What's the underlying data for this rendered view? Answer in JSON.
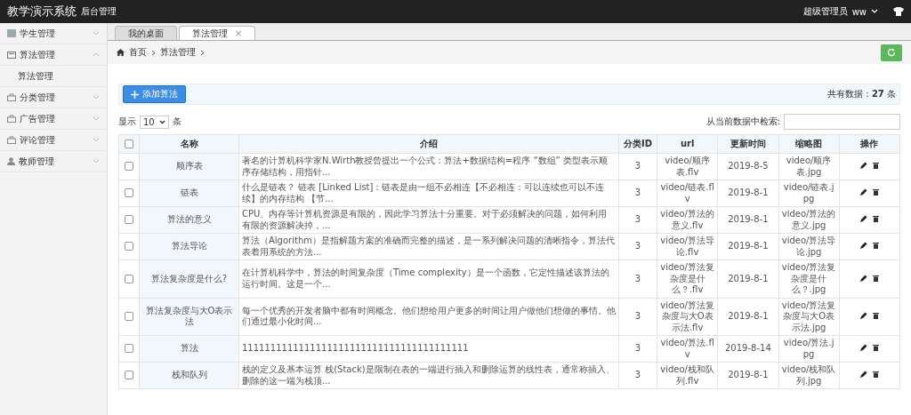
{
  "header": {
    "title": "教学演示系统",
    "subtitle": "后台管理",
    "user_role": "超级管理员",
    "user_name": "ww"
  },
  "sidebar": {
    "items": [
      {
        "label": "学生管理",
        "expanded": false
      },
      {
        "label": "算法管理",
        "expanded": true,
        "children": [
          {
            "label": "算法管理"
          }
        ]
      },
      {
        "label": "分类管理",
        "expanded": false
      },
      {
        "label": "广告管理",
        "expanded": false
      },
      {
        "label": "评论管理",
        "expanded": false
      },
      {
        "label": "教师管理",
        "expanded": false
      }
    ]
  },
  "tabs": [
    {
      "label": "我的桌面",
      "selected": false
    },
    {
      "label": "算法管理",
      "selected": true,
      "close": "×"
    }
  ],
  "breadcrumb": [
    "首页",
    "算法管理"
  ],
  "toolbar": {
    "add_button": "添加算法",
    "total_label": "共有数据：",
    "total": "27",
    "total_unit": "条"
  },
  "length_menu": {
    "prefix": "显示",
    "value": "10",
    "suffix": "条"
  },
  "search": {
    "label": "从当前数据中检索:"
  },
  "table": {
    "select_all_checked": false,
    "columns": [
      "名称",
      "介绍",
      "分类ID",
      "url",
      "更新时间",
      "缩略图",
      "操作"
    ],
    "rows": [
      {
        "checked": false,
        "name": "顺序表",
        "intro": "著名的计算机科学家N.Wirth教授曾提出一个公式：算法+数据结构=程序 “数组” 类型表示顺序存储结构，用指针...",
        "category": "3",
        "url": "video/顺序表.flv",
        "updated": "2019-8-5",
        "thumb": "video/顺序表.jpg"
      },
      {
        "checked": false,
        "name": "链表",
        "intro": "什么是链表？ 链表 [Linked List]：链表是由一组不必相连【不必相连：可以连续也可以不连续】的内存结构 【节...",
        "category": "3",
        "url": "video/链表.flv",
        "updated": "2019-8-1",
        "thumb": "video/链表.jpg"
      },
      {
        "checked": false,
        "name": "算法的意义",
        "intro": "CPU、内存等计算机资源是有限的，因此学习算法十分重要。对于必须解决的问题，如何利用有限的资源解决掉，...",
        "category": "3",
        "url": "video/算法的意义.flv",
        "updated": "2019-8-1",
        "thumb": "video/算法的意义.jpg"
      },
      {
        "checked": false,
        "name": "算法导论",
        "intro": "算法（Algorithm）是指解题方案的准确而完整的描述，是一系列解决问题的清晰指令，算法代表着用系统的方法...",
        "category": "3",
        "url": "video/算法导论.flv",
        "updated": "2019-8-1",
        "thumb": "video/算法导论.jpg"
      },
      {
        "checked": false,
        "name": "算法复杂度是什么?",
        "intro": "在计算机科学中，算法的时间复杂度（Time complexity）是一个函数，它定性描述该算法的运行时间。这是一个...",
        "category": "3",
        "url": "video/算法复杂度是什么？.flv",
        "updated": "2019-8-1",
        "thumb": "video/算法复杂度是什么？.jpg"
      },
      {
        "checked": false,
        "name": "算法复杂度与大O表示法",
        "intro": "每一个优秀的开发者脑中都有时间概念。他们想给用户更多的时间让用户做他们想做的事情。他们通过最小化时间...",
        "category": "3",
        "url": "video/算法复杂度与大O表示法.flv",
        "updated": "2019-8-1",
        "thumb": "video/算法复杂度与大O表示法.jpg"
      },
      {
        "checked": false,
        "name": "算法",
        "intro": "1111111111111111111111111111111111111111",
        "category": "3",
        "url": "video/算法.flv",
        "updated": "2019-8-14",
        "thumb": "video/算法.jpg"
      },
      {
        "checked": false,
        "name": "栈和队列",
        "intro": "栈的定义及基本运算 栈(Stack)是限制在表的一端进行插入和删除运算的线性表，通常称插入、删除的这一端为栈顶...",
        "category": "3",
        "url": "video/栈和队列.flv",
        "updated": "2019-8-1",
        "thumb": "video/栈和队列.jpg"
      }
    ]
  }
}
